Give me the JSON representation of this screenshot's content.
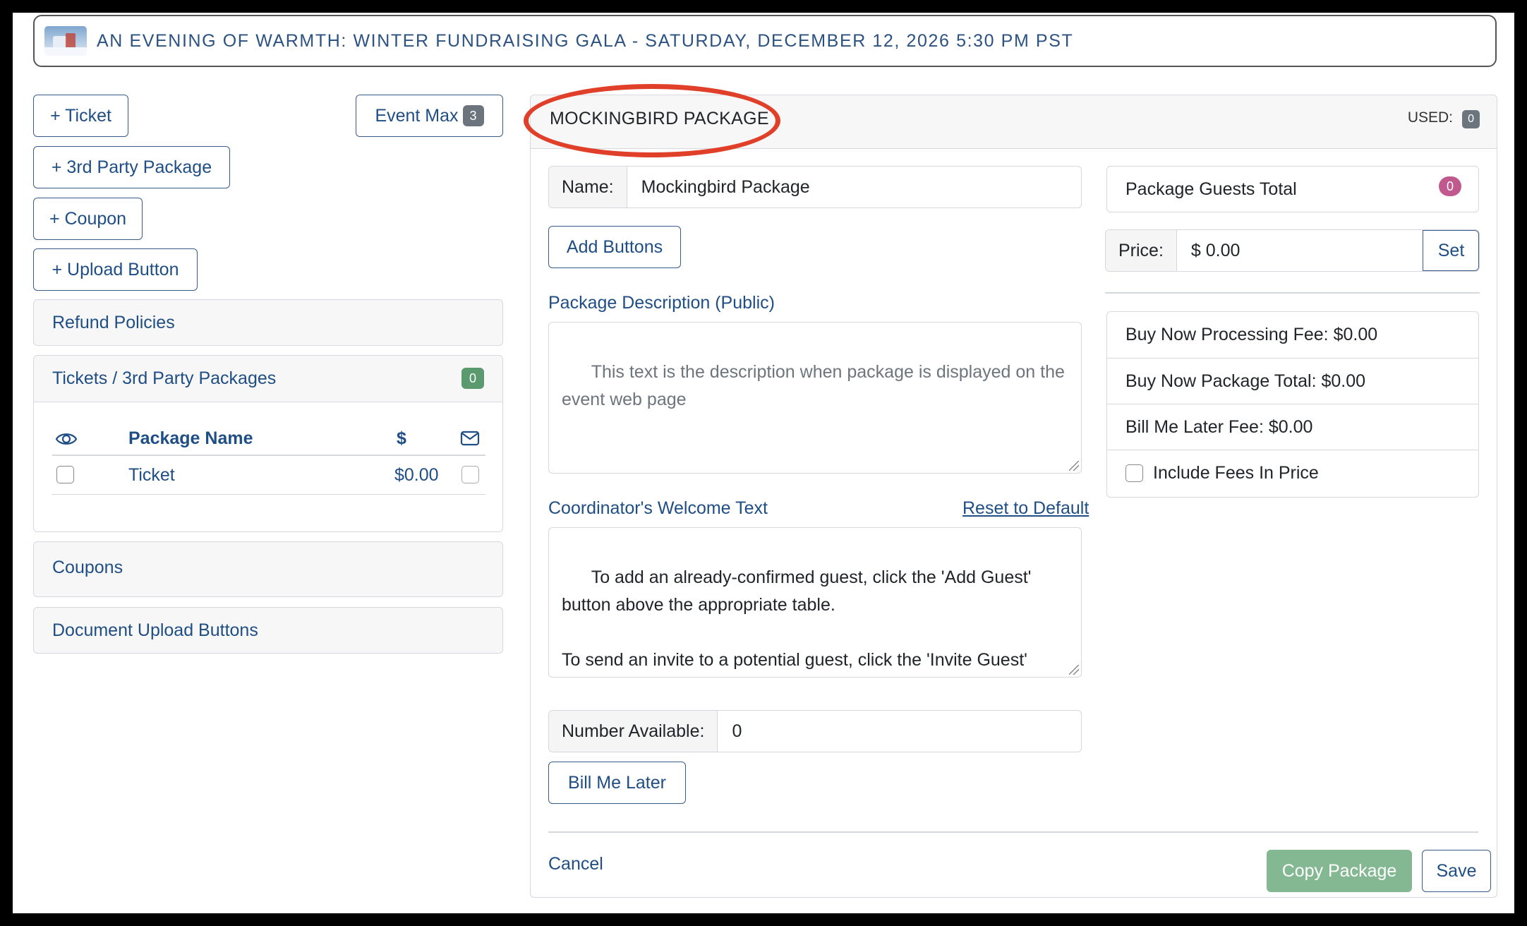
{
  "event": {
    "title": "AN EVENING OF WARMTH: WINTER FUNDRAISING GALA - SATURDAY, DECEMBER 12, 2026 5:30 PM PST"
  },
  "sidebar": {
    "add_ticket": "+ Ticket",
    "event_max_label": "Event Max",
    "event_max_count": "3",
    "add_3rd_party": "+ 3rd Party Package",
    "add_coupon": "+ Coupon",
    "add_upload": "+ Upload Button",
    "refund_policies": "Refund Policies",
    "tickets_panel": {
      "title": "Tickets / 3rd Party Packages",
      "count": "0",
      "columns": {
        "name": "Package Name",
        "price": "$"
      },
      "rows": [
        {
          "name": "Ticket",
          "price": "$0.00"
        }
      ]
    },
    "coupons": "Coupons",
    "upload_buttons": "Document Upload Buttons"
  },
  "package": {
    "header_title": "MOCKINGBIRD PACKAGE",
    "used_label": "USED:",
    "used_count": "0",
    "name_label": "Name:",
    "name_value": "Mockingbird Package",
    "add_buttons": "Add Buttons",
    "description_label": "Package Description (Public)",
    "description_placeholder": "This text is the description when package is displayed on the event web page",
    "welcome_label": "Coordinator's Welcome Text",
    "reset_default": "Reset to Default",
    "welcome_text": "To add an already-confirmed guest, click the 'Add Guest' button above the appropriate table.\n\nTo send an invite to a potential guest, click the 'Invite Guest' button above the appropriate table. The guest will receive an",
    "number_available_label": "Number Available:",
    "number_available_value": "0",
    "bill_me_later": "Bill Me Later",
    "guests_total_label": "Package Guests Total",
    "guests_total_count": "0",
    "price_label": "Price:",
    "price_value": "$ 0.00",
    "set_button": "Set",
    "fees": {
      "processing": "Buy Now Processing Fee: $0.00",
      "package_total": "Buy Now Package Total: $0.00",
      "bill_later_fee": "Bill Me Later Fee: $0.00",
      "include_fees": "Include Fees In Price"
    },
    "cancel": "Cancel",
    "copy_package": "Copy Package",
    "save": "Save"
  },
  "colors": {
    "accent": "#1f4e85",
    "highlight_circle": "#e0402a",
    "copy_button": "#84b893",
    "count_badge": "#5a9a6e",
    "guests_badge": "#c05a8e"
  }
}
